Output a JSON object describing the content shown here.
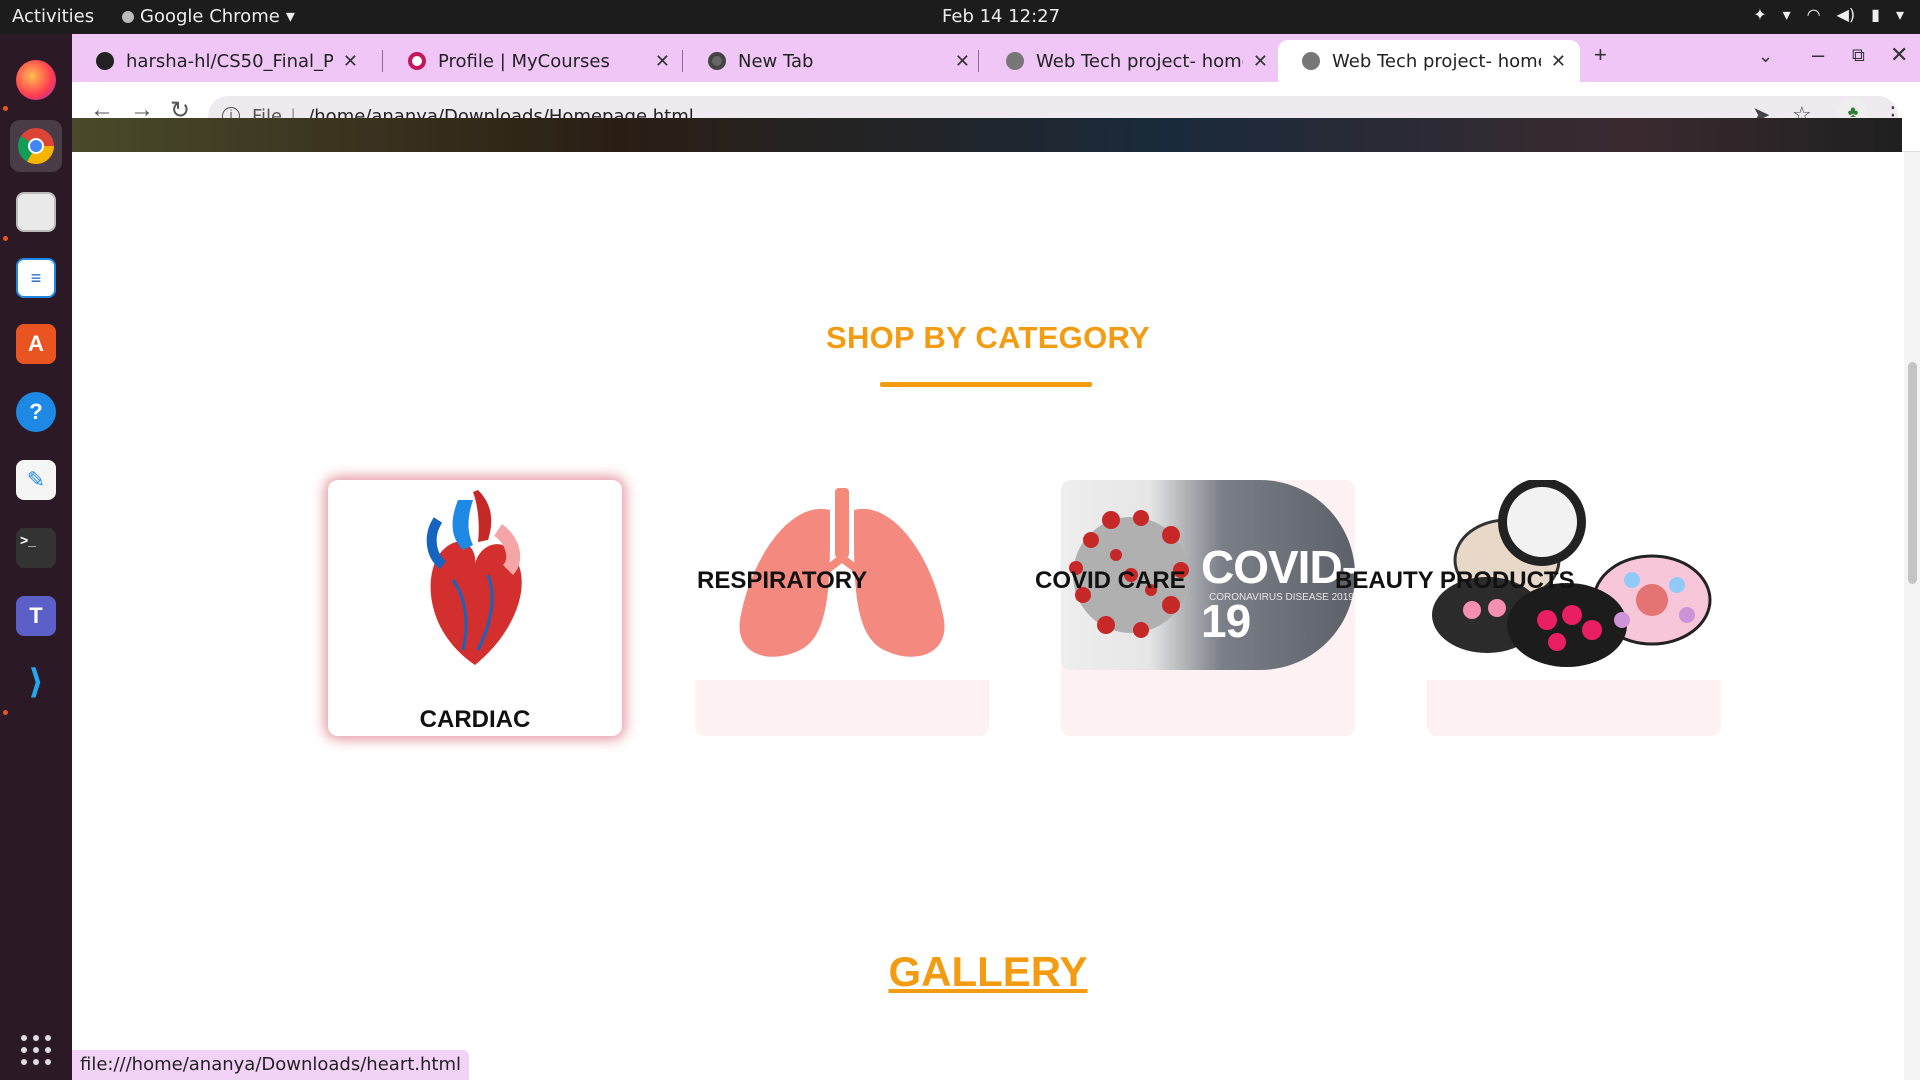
{
  "topbar": {
    "activities": "Activities",
    "app_menu": "Google Chrome",
    "clock": "Feb 14  12:27"
  },
  "tabs": [
    {
      "title": "harsha-hl/CS50_Final_Pro",
      "icon": "github-icon"
    },
    {
      "title": "Profile | MyCourses",
      "icon": "mycourses-icon"
    },
    {
      "title": "New Tab",
      "icon": "chrome-icon"
    },
    {
      "title": "Web Tech project- homep",
      "icon": "globe-icon"
    },
    {
      "title": "Web Tech project- homep",
      "icon": "globe-icon"
    }
  ],
  "omnibox": {
    "scheme": "File",
    "url": "/home/ananya/Downloads/Homepage.html"
  },
  "section": {
    "title": "SHOP BY CATEGORY",
    "accent": "#f39c12"
  },
  "categories": [
    {
      "label": "CARDIAC",
      "image": "heart-image"
    },
    {
      "label": "RESPIRATORY",
      "image": "lungs-image"
    },
    {
      "label": "COVID CARE",
      "image": "covid-image",
      "image_text": "COVID-19",
      "image_subtext": "CORONAVIRUS DISEASE 2019"
    },
    {
      "label": "BEAUTY PRODUCTS",
      "image": "makeup-image"
    }
  ],
  "gallery": {
    "title": "GALLERY"
  },
  "statusbar": {
    "link": "file:///home/ananya/Downloads/heart.html"
  }
}
